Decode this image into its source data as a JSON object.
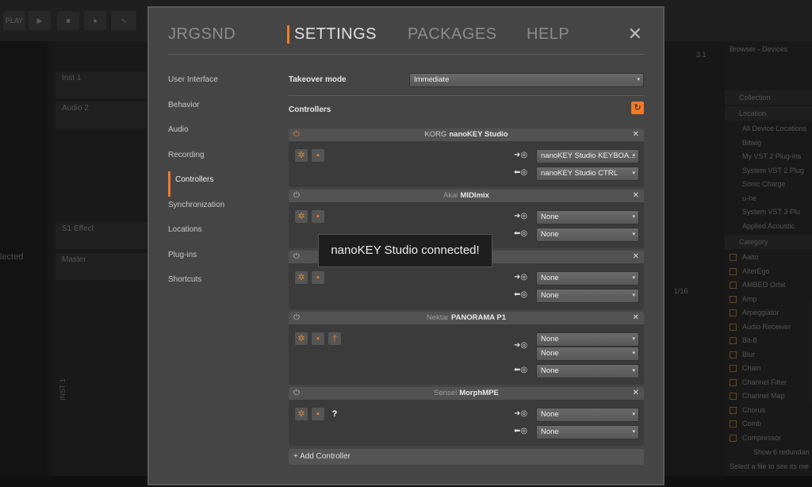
{
  "background": {
    "play_label": "PLAY",
    "left_text": "lected",
    "tracks": [
      "Inst 1",
      "Audio 2",
      "S1 Effect",
      "Master"
    ],
    "track_lane_label": "INST 1",
    "timeline_marker": "3.1",
    "page_indicator": "1/16",
    "browser": {
      "title": "Browser - Devices",
      "sections": [
        "Collection",
        "Location",
        "Category"
      ],
      "locations": [
        "All Device Locations",
        "Bitwig",
        "My VST 2 Plug-ins",
        "System VST 2 Plug",
        "Sonic Charge",
        "u-he",
        "System VST 3 Plu",
        "Applied Acoustic"
      ],
      "categories": [
        "Aalto",
        "AlterEgo",
        "AMBEO Orbit",
        "Amp",
        "Arpeggiator",
        "Audio Receiver",
        "Bit-8",
        "Blur",
        "Chain",
        "Channel Filter",
        "Channel Map",
        "Chorus",
        "Comb",
        "Compressor"
      ],
      "show_more": "Show 6 redundan",
      "footer": "Select a file to see its me"
    }
  },
  "nav": {
    "tabs": [
      "JRGSND",
      "SETTINGS",
      "PACKAGES",
      "HELP"
    ],
    "active": "SETTINGS"
  },
  "sidebar": {
    "items": [
      "User Interface",
      "Behavior",
      "Audio",
      "Recording",
      "Controllers",
      "Synchronization",
      "Locations",
      "Plug-ins",
      "Shortcuts"
    ],
    "active": "Controllers"
  },
  "settings": {
    "takeover_label": "Takeover mode",
    "takeover_value": "Immediate",
    "controllers_label": "Controllers"
  },
  "controllers": [
    {
      "vendor": "KORG",
      "model": "nanoKEY Studio",
      "enabled": true,
      "in": [
        "nanoKEY Studio KEYBOA..."
      ],
      "out": "nanoKEY Studio CTRL"
    },
    {
      "vendor": "Akai",
      "model": "MIDImix",
      "enabled": false,
      "in": [
        "None"
      ],
      "out": "None"
    },
    {
      "vendor": "",
      "model": "",
      "enabled": false,
      "in": [
        "None"
      ],
      "out": "None"
    },
    {
      "vendor": "Nektar",
      "model": "PANORAMA P1",
      "enabled": false,
      "in": [
        "None",
        "None"
      ],
      "out": "None"
    },
    {
      "vendor": "Sensel",
      "model": "MorphMPE",
      "enabled": false,
      "in": [
        "None"
      ],
      "out": "None"
    }
  ],
  "add_controller_label": "+ Add Controller",
  "toast": "nanoKEY Studio connected!",
  "glyphs": {
    "close": "✕",
    "caret": "▾",
    "power": "⏻",
    "x": "✕",
    "gear": "✲",
    "chat": "▪",
    "pin": "†",
    "help": "?",
    "refresh": "↻",
    "in_arrow": "➜◎",
    "out_arrow": "⬅◎"
  },
  "colors": {
    "accent": "#f07a2a",
    "modal_bg": "#454545",
    "card_bg": "#3b3b3b"
  }
}
